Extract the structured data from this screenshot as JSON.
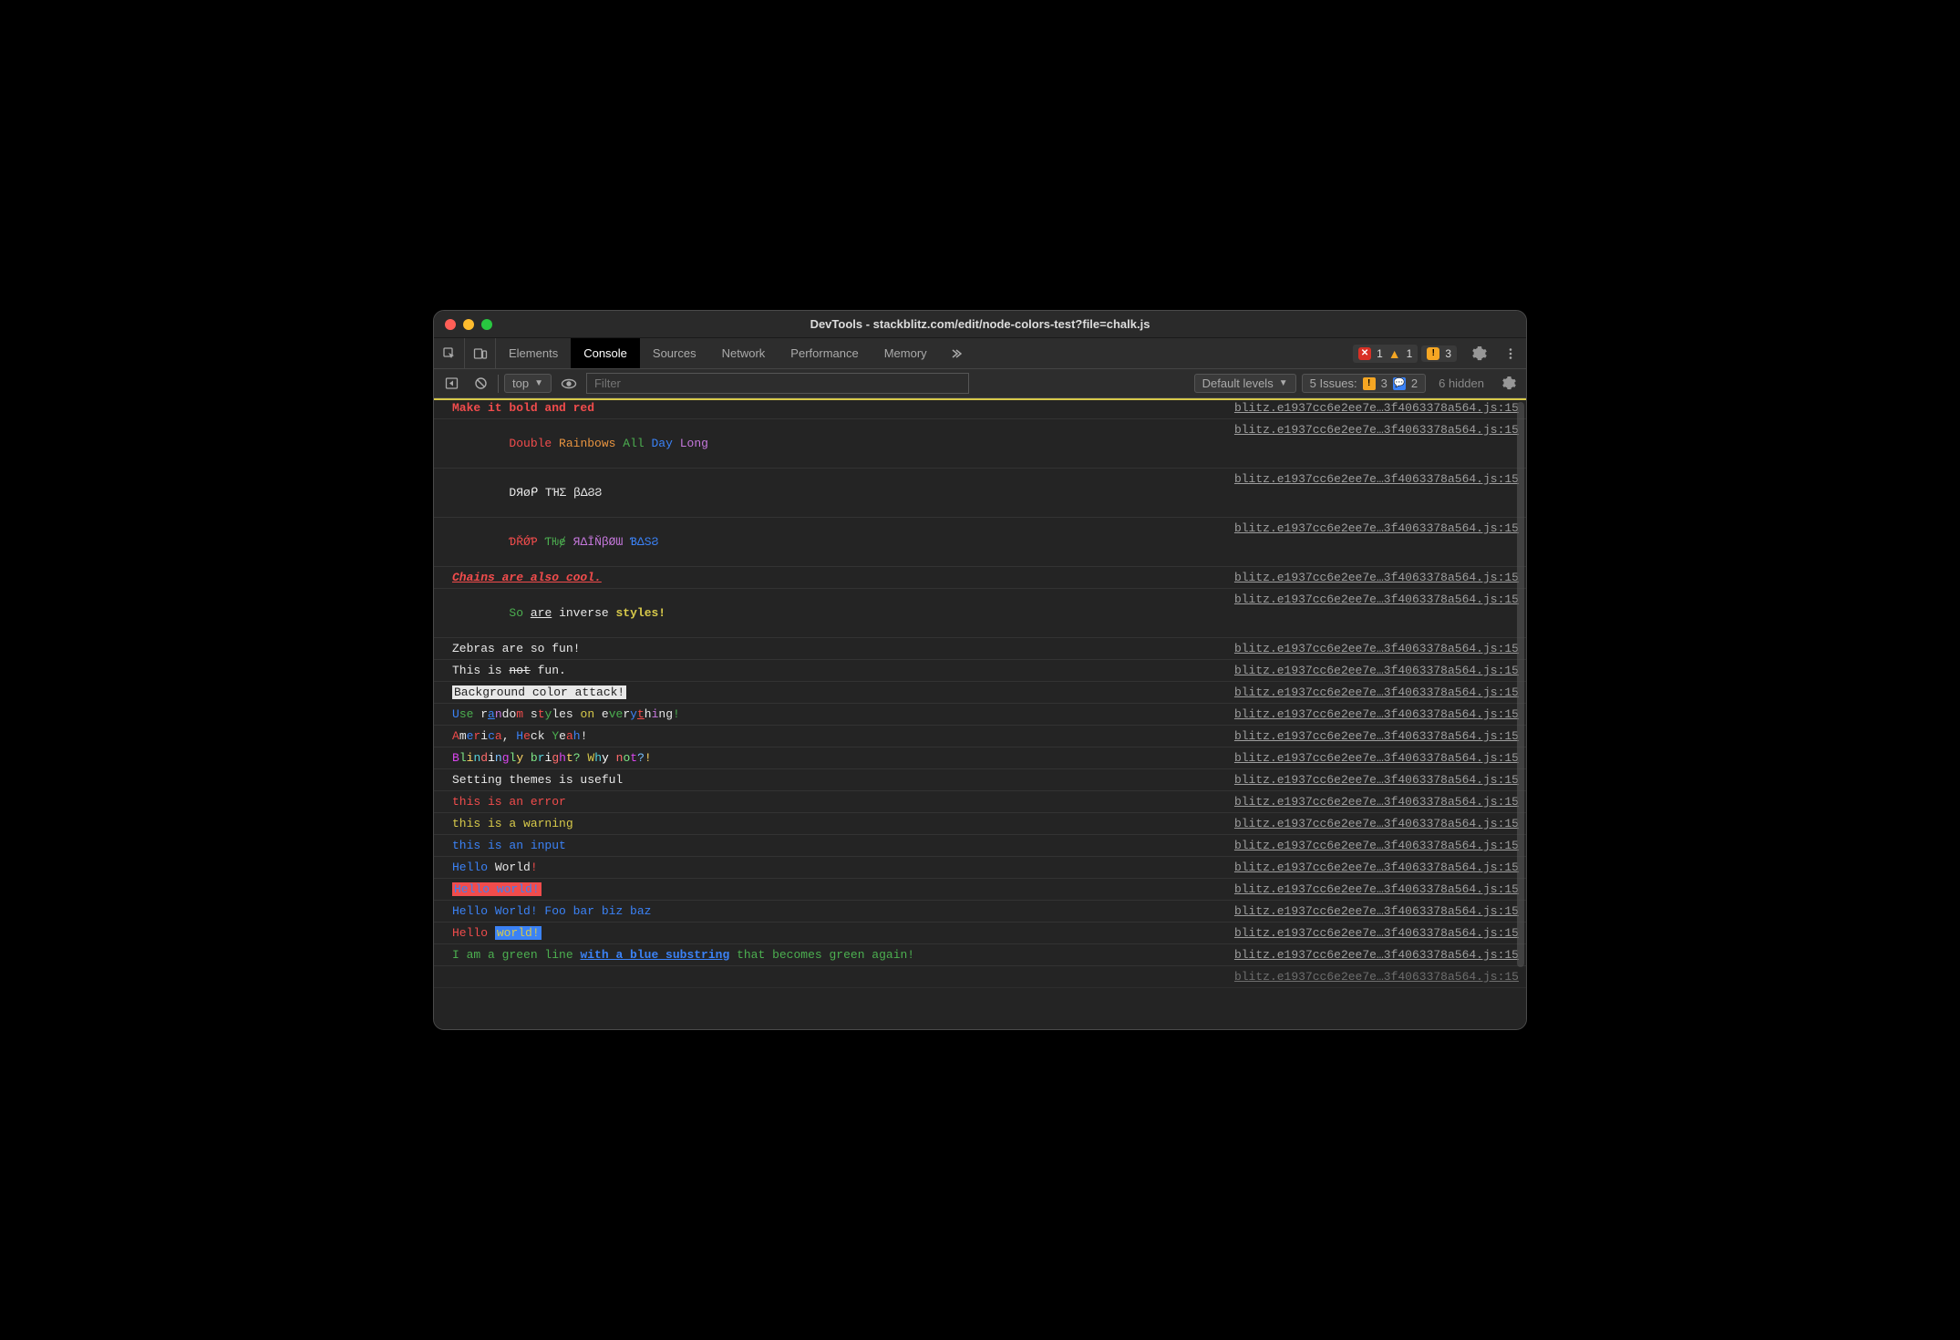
{
  "window": {
    "title": "DevTools - stackblitz.com/edit/node-colors-test?file=chalk.js"
  },
  "tabs": {
    "elements": "Elements",
    "console": "Console",
    "sources": "Sources",
    "network": "Network",
    "performance": "Performance",
    "memory": "Memory"
  },
  "badges": {
    "errors": "1",
    "warnings": "1",
    "issues": "3"
  },
  "toolbar": {
    "context": "top",
    "filter_placeholder": "Filter",
    "levels_label": "Default levels",
    "issues_label": "5 Issues:",
    "issues_yellow": "3",
    "issues_blue": "2",
    "hidden": "6 hidden"
  },
  "source_link": "blitz.e1937cc6e2ee7e…3f4063378a564.js:15",
  "lines": {
    "l1": {
      "t1": "Make it bold and red"
    },
    "l2": {
      "t1": "Double",
      "t2": "Rainbows",
      "t3": "All",
      "t4": "Day",
      "t5": "Long"
    },
    "l3": {
      "t1": "DЯøᑭ",
      "t2": "TΉΣ",
      "t3": "βΔϨϨ"
    },
    "l4": {
      "t1": "ƊŘǾƤ",
      "t2": "ƬǶɇ",
      "t3": "ЯΔĪŇβØƜ",
      "t4": "ƁΔЅϨ"
    },
    "l5": {
      "t1": "Chains are also cool."
    },
    "l6": {
      "t1": "So",
      "t2": "are",
      "t3": "inverse",
      "t4": "styles!"
    },
    "l7": {
      "t1": "Zebras are so fun!"
    },
    "l8": {
      "t1": "This is ",
      "t2": "not",
      "t3": " fun."
    },
    "l9": {
      "t1": "Background color attack!"
    },
    "l10": {
      "t1": "U",
      "t2": "se",
      "t3": " r",
      "t4": "a",
      "t5": "n",
      "t6": "do",
      "t7": "m",
      "t8": " s",
      "t9": "t",
      "t10": "y",
      "t11": "les",
      "t12": " on",
      "t13": " e",
      "t14": "ve",
      "t15": "r",
      "t16": "y",
      "t17": "t",
      "t18": "h",
      "t19": "i",
      "t20": "ng",
      "t21": "!"
    },
    "l11": {
      "t1": "A",
      "t2": "m",
      "t3": "e",
      "t4": "r",
      "t5": "i",
      "t6": "c",
      "t7": "a",
      "t8": ",",
      "t9": " H",
      "t10": "e",
      "t11": "ck",
      "t12": " Y",
      "t13": "e",
      "t14": "a",
      "t15": "h",
      "t16": "!"
    },
    "l12": {
      "t1": "B",
      "t2": "l",
      "t3": "i",
      "t4": "n",
      "t5": "d",
      "t6": "i",
      "t7": "n",
      "t8": "g",
      "t9": "l",
      "t10": "y",
      "t11": " b",
      "t12": "r",
      "t13": "i",
      "t14": "g",
      "t15": "h",
      "t16": "t",
      "t17": "?",
      "t18": " W",
      "t19": "h",
      "t20": "y",
      "t21": " n",
      "t22": "o",
      "t23": "t",
      "t24": "?",
      "t25": "!"
    },
    "l13": {
      "t1": "Setting themes is useful"
    },
    "l14": {
      "t1": "this is an error"
    },
    "l15": {
      "t1": "this is a warning"
    },
    "l16": {
      "t1": "this is an input"
    },
    "l17": {
      "t1": "Hello",
      "t2": " World",
      "t3": "!"
    },
    "l18": {
      "t1": "Hello world!"
    },
    "l19": {
      "t1": "Hello World!",
      "t2": " Foo bar biz baz"
    },
    "l20": {
      "t1": "Hello ",
      "t2": "world!"
    },
    "l21": {
      "t1": "I am a green line ",
      "t2": "with a blue substring",
      "t3": " that becomes green again!"
    }
  }
}
